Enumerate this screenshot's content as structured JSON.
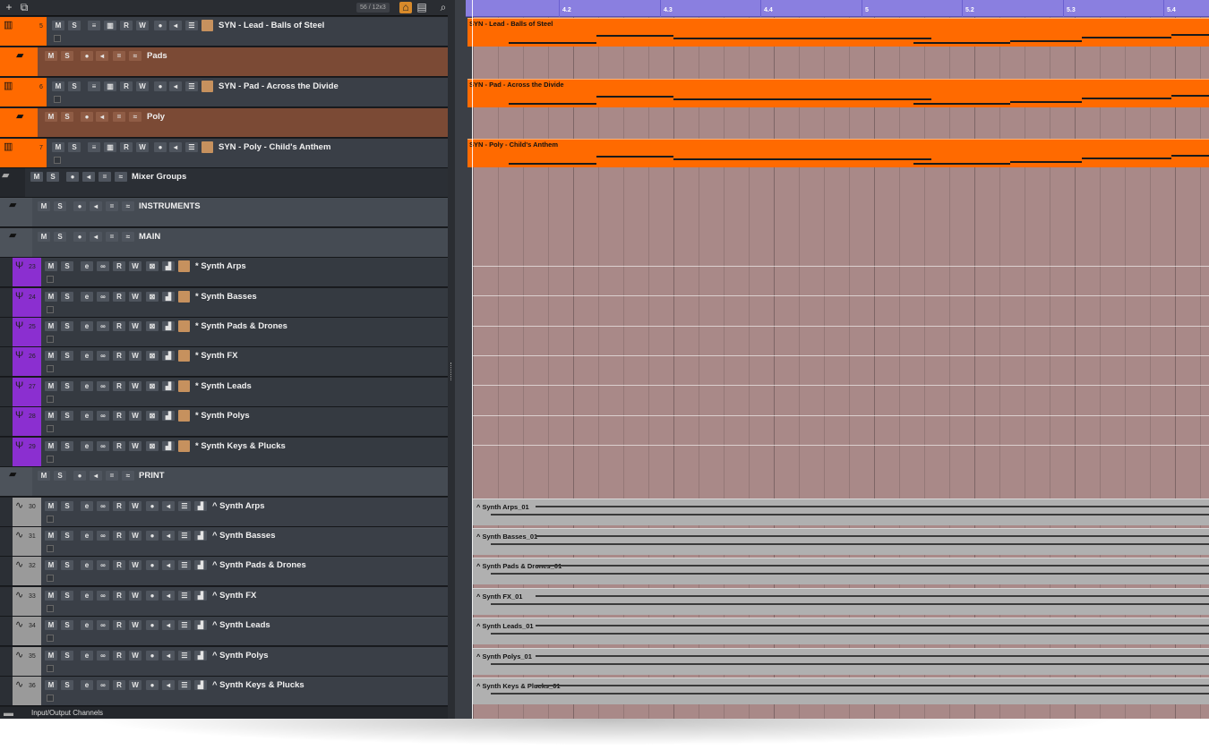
{
  "toolbar": {
    "add_icon": "plus-icon",
    "import_icon": "import-icon",
    "track_count": "56 / 12x3"
  },
  "ruler": {
    "labels": [
      "4.2",
      "4.3",
      "4.4",
      "5",
      "5.2",
      "5.3",
      "5.4"
    ]
  },
  "tracks": [
    {
      "kind": "instrument",
      "num": "5",
      "name": "SYN - Lead - Balls of Steel",
      "color": "#ff6a00"
    },
    {
      "kind": "folder",
      "name": "Pads",
      "color": "#ff6a00"
    },
    {
      "kind": "instrument",
      "num": "6",
      "name": "SYN - Pad - Across the Divide",
      "color": "#ff6a00"
    },
    {
      "kind": "folder",
      "name": "Poly",
      "color": "#ff6a00"
    },
    {
      "kind": "instrument",
      "num": "7",
      "name": "SYN - Poly - Child's Anthem",
      "color": "#ff6a00"
    },
    {
      "kind": "mixer",
      "name": "Mixer Groups"
    },
    {
      "kind": "subfolder",
      "name": "INSTRUMENTS"
    },
    {
      "kind": "subfolder",
      "name": "MAIN"
    },
    {
      "kind": "group",
      "num": "23",
      "name": "* Synth Arps",
      "color": "#8b2fd0"
    },
    {
      "kind": "group",
      "num": "24",
      "name": "* Synth Basses",
      "color": "#8b2fd0"
    },
    {
      "kind": "group",
      "num": "25",
      "name": "* Synth Pads & Drones",
      "color": "#8b2fd0"
    },
    {
      "kind": "group",
      "num": "26",
      "name": "* Synth FX",
      "color": "#8b2fd0"
    },
    {
      "kind": "group",
      "num": "27",
      "name": "* Synth Leads",
      "color": "#8b2fd0"
    },
    {
      "kind": "group",
      "num": "28",
      "name": "* Synth Polys",
      "color": "#8b2fd0"
    },
    {
      "kind": "group",
      "num": "29",
      "name": "* Synth Keys & Plucks",
      "color": "#8b2fd0"
    },
    {
      "kind": "subfolder",
      "name": "PRINT"
    },
    {
      "kind": "audio",
      "num": "30",
      "name": "^ Synth Arps",
      "color": "#9a9a9a"
    },
    {
      "kind": "audio",
      "num": "31",
      "name": "^ Synth Basses",
      "color": "#9a9a9a"
    },
    {
      "kind": "audio",
      "num": "32",
      "name": "^ Synth Pads & Drones",
      "color": "#9a9a9a"
    },
    {
      "kind": "audio",
      "num": "33",
      "name": "^ Synth FX",
      "color": "#9a9a9a"
    },
    {
      "kind": "audio",
      "num": "34",
      "name": "^ Synth Leads",
      "color": "#9a9a9a"
    },
    {
      "kind": "audio",
      "num": "35",
      "name": "^ Synth Polys",
      "color": "#9a9a9a"
    },
    {
      "kind": "audio",
      "num": "36",
      "name": "^ Synth Keys & Plucks",
      "color": "#9a9a9a"
    }
  ],
  "buttons": {
    "mute": "M",
    "solo": "S",
    "read": "R",
    "write": "W"
  },
  "parts": [
    {
      "name": "SYN - Lead - Balls of Steel"
    },
    {
      "name": "SYN - Pad - Across the Divide"
    },
    {
      "name": "SYN - Poly - Child's Anthem"
    }
  ],
  "audio_events": [
    {
      "name": "^ Synth Arps_01"
    },
    {
      "name": "^ Synth Basses_01"
    },
    {
      "name": "^ Synth Pads & Drones_01"
    },
    {
      "name": "^ Synth FX_01"
    },
    {
      "name": "^ Synth Leads_01"
    },
    {
      "name": "^ Synth Polys_01"
    },
    {
      "name": "^ Synth Keys & Plucks_01"
    }
  ],
  "footer": {
    "label": "Input/Output Channels"
  }
}
